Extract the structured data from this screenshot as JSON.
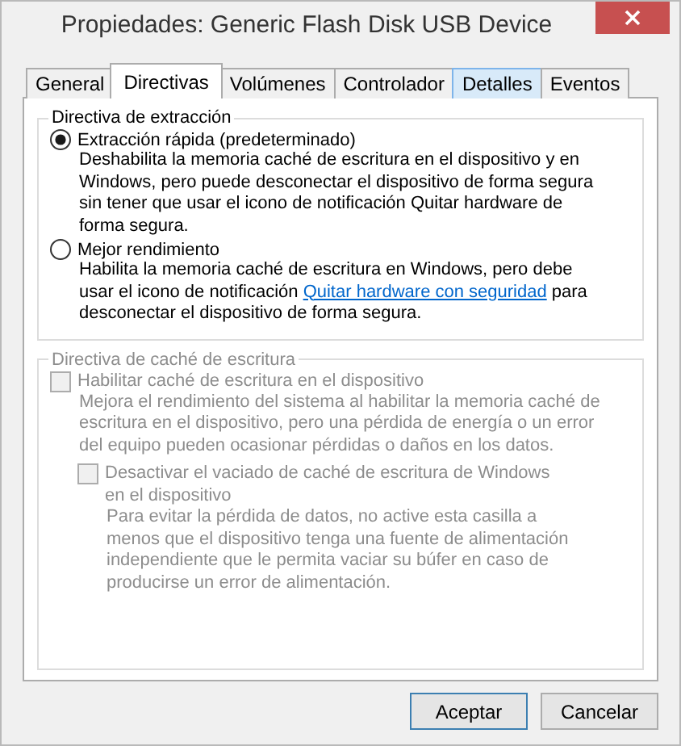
{
  "window": {
    "title": "Propiedades: Generic Flash Disk USB Device"
  },
  "tabs": [
    {
      "label": "General",
      "selected": false,
      "hovered": false
    },
    {
      "label": "Directivas",
      "selected": true,
      "hovered": false
    },
    {
      "label": "Volúmenes",
      "selected": false,
      "hovered": false
    },
    {
      "label": "Controlador",
      "selected": false,
      "hovered": false
    },
    {
      "label": "Detalles",
      "selected": false,
      "hovered": true
    },
    {
      "label": "Eventos",
      "selected": false,
      "hovered": false
    }
  ],
  "removal_policy": {
    "title": "Directiva de extracción",
    "options": [
      {
        "label": "Extracción rápida (predeterminado)",
        "selected": true,
        "description": "Deshabilita la memoria caché de escritura en el dispositivo y en Windows, pero puede desconectar el dispositivo de forma segura sin tener que usar el icono de notificación Quitar hardware de forma segura."
      },
      {
        "label": "Mejor rendimiento",
        "selected": false,
        "description": "Habilita la memoria caché de escritura en Windows, pero debe usar el icono de notificación",
        "link": "Quitar hardware con seguridad",
        "description_after": "para desconectar el dispositivo de forma segura."
      }
    ]
  },
  "write_cache_policy": {
    "title": "Directiva de caché de escritura",
    "disabled": true,
    "checkboxes": [
      {
        "label": "Habilitar caché de escritura en el dispositivo",
        "checked": false,
        "disabled": true,
        "description": "Mejora el rendimiento del sistema al habilitar la memoria caché de escritura en el dispositivo, pero una pérdida de energía o un error del equipo pueden ocasionar pérdidas o daños en los datos.",
        "children": [
          {
            "label": "Desactivar el vaciado de caché de escritura de Windows en el dispositivo",
            "checked": false,
            "disabled": true,
            "description": "Para evitar la pérdida de datos, no active esta casilla a menos que el dispositivo tenga una fuente de alimentación independiente que le permita vaciar su búfer en caso de producirse un error de alimentación."
          }
        ]
      }
    ]
  },
  "buttons": [
    {
      "label": "Aceptar",
      "default": true
    },
    {
      "label": "Cancelar",
      "default": false
    }
  ]
}
